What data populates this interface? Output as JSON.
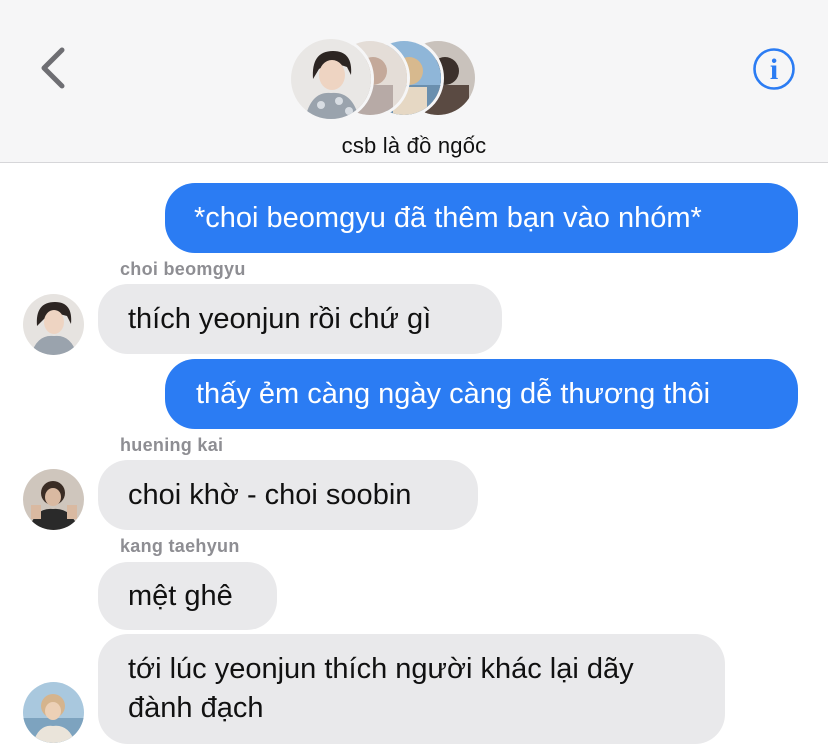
{
  "header": {
    "group_name": "csb là đồ ngốc"
  },
  "messages": [
    {
      "direction": "outgoing",
      "text": "*choi beomgyu đã thêm bạn vào nhóm*"
    },
    {
      "direction": "incoming",
      "sender": "choi beomgyu",
      "text": "thích yeonjun rồi chứ gì"
    },
    {
      "direction": "outgoing",
      "text": "thấy ẻm càng ngày càng dễ thương thôi"
    },
    {
      "direction": "incoming",
      "sender": "huening kai",
      "text": "choi khờ - choi soobin"
    },
    {
      "direction": "incoming",
      "sender": "kang taehyun",
      "text": "mệt ghê"
    },
    {
      "direction": "incoming",
      "sender": "kang taehyun",
      "text_line1": "tới lúc yeonjun thích người khác lại dãy",
      "text_line2": "đành đạch"
    }
  ],
  "colors": {
    "outgoing_bubble": "#2b7cf3",
    "incoming_bubble": "#e9e9eb",
    "header_bg": "#f6f6f7",
    "accent": "#2b7cf3",
    "sender_name": "#8e8e93"
  },
  "icons": {
    "back": "chevron-left-icon",
    "info": "info-icon"
  }
}
